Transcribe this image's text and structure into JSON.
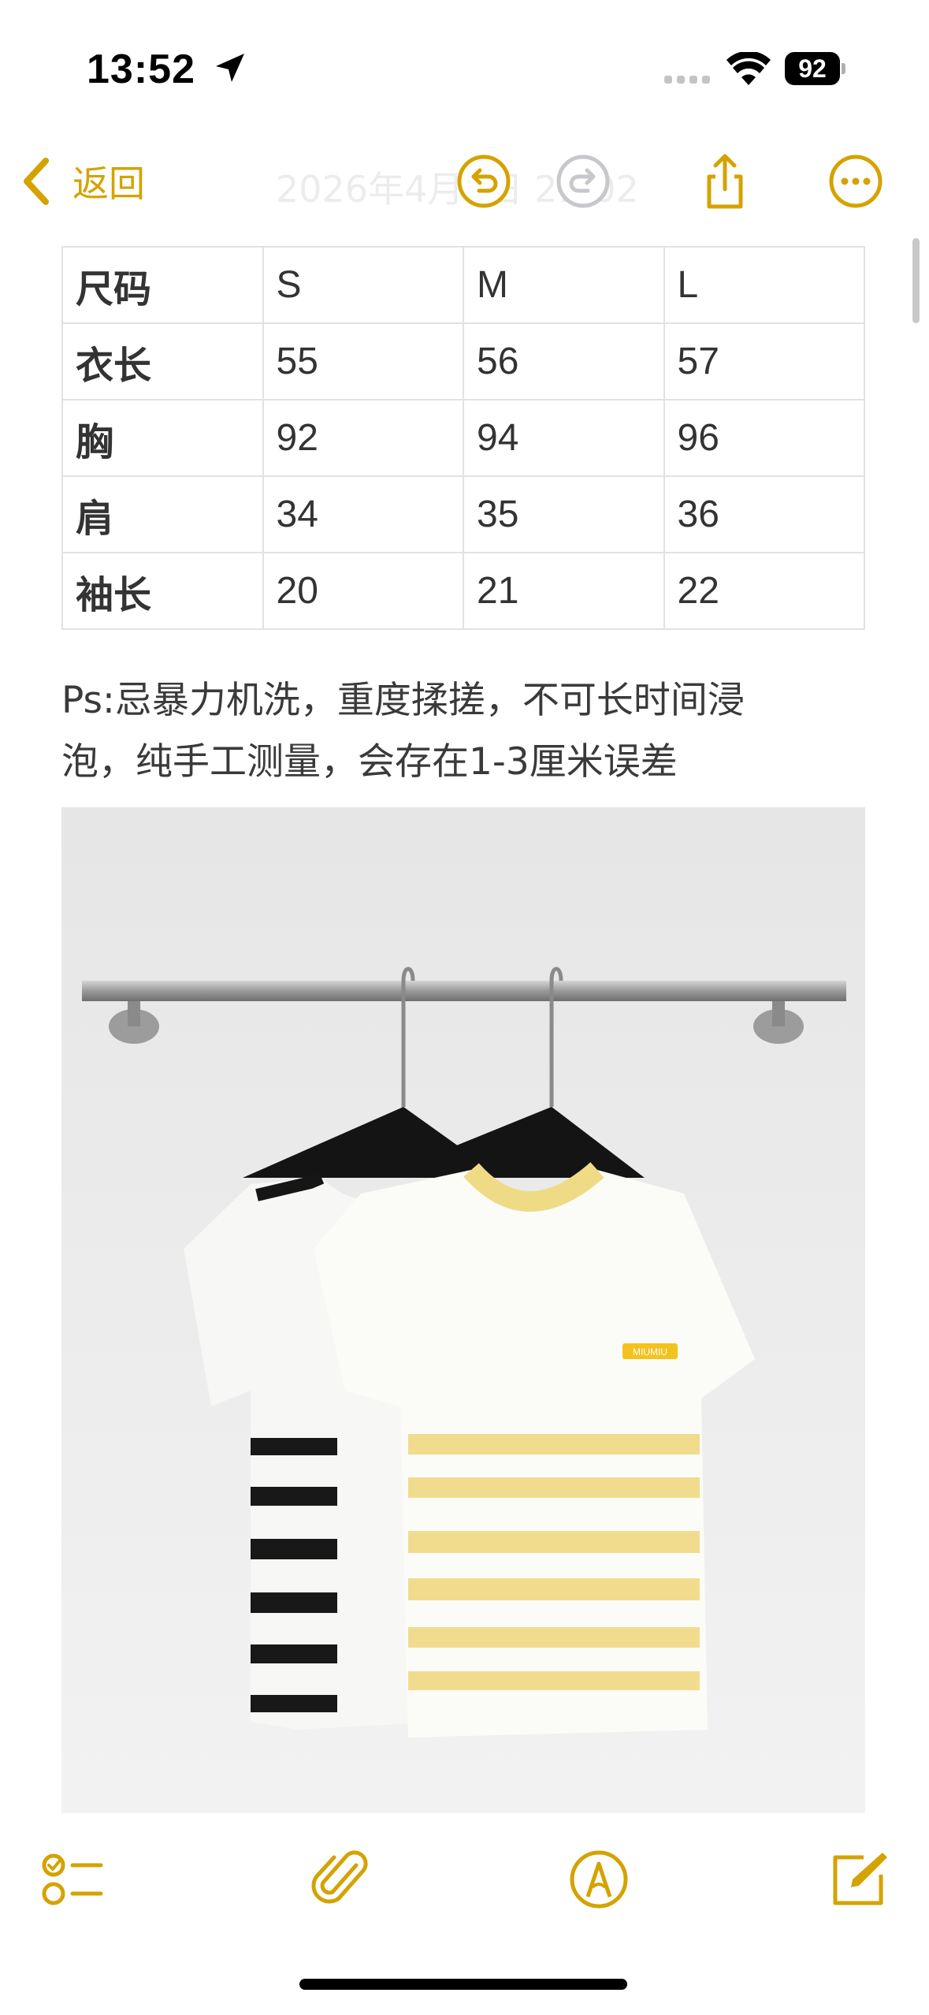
{
  "status_bar": {
    "time": "13:52",
    "battery": "92",
    "icons": [
      "location-arrow-icon",
      "cellular-signal-icon",
      "wifi-icon",
      "battery-icon"
    ]
  },
  "nav": {
    "back_label": "返回",
    "title": "2026年4月6日 21:02",
    "buttons": [
      "undo-icon",
      "redo-icon",
      "share-icon",
      "more-icon"
    ]
  },
  "size_table": {
    "rows": [
      [
        "尺码",
        "S",
        "M",
        "L"
      ],
      [
        "衣长",
        "55",
        "56",
        "57"
      ],
      [
        "胸",
        "92",
        "94",
        "96"
      ],
      [
        "肩",
        "34",
        "35",
        "36"
      ],
      [
        "袖长",
        "20",
        "21",
        "22"
      ]
    ]
  },
  "note": {
    "line1": "Ps:忌暴力机洗，重度揉搓，不可长时间浸",
    "line2": "泡，纯手工测量，会存在1-3厘米误差"
  },
  "photo": {
    "subject": "two striped knit short-sleeve tops on hangers",
    "badge_text": "MIUMIU"
  },
  "toolbar": {
    "buttons": [
      "checklist-icon",
      "paperclip-icon",
      "markup-pen-icon",
      "compose-icon"
    ]
  },
  "colors": {
    "accent": "#D4A300",
    "disabled": "#C7C7CC",
    "table_border": "#E2E2E2",
    "text": "#333333"
  }
}
